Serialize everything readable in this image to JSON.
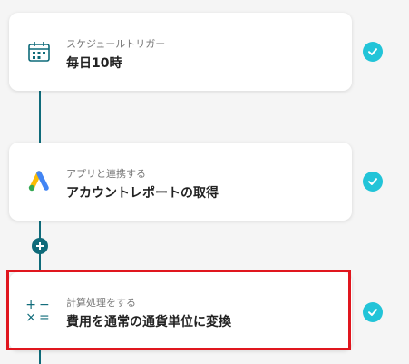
{
  "steps": [
    {
      "subtitle": "スケジュールトリガー",
      "title": "毎日10時",
      "icon": "calendar-icon"
    },
    {
      "subtitle": "アプリと連携する",
      "title": "アカウントレポートの取得",
      "icon": "google-ads-icon"
    },
    {
      "subtitle": "計算処理をする",
      "title": "費用を通常の通貨単位に変換",
      "icon": "calculator-icon"
    }
  ],
  "colors": {
    "accent": "#0f6b7a",
    "check": "#22c4d8",
    "highlight": "#e0161e"
  }
}
